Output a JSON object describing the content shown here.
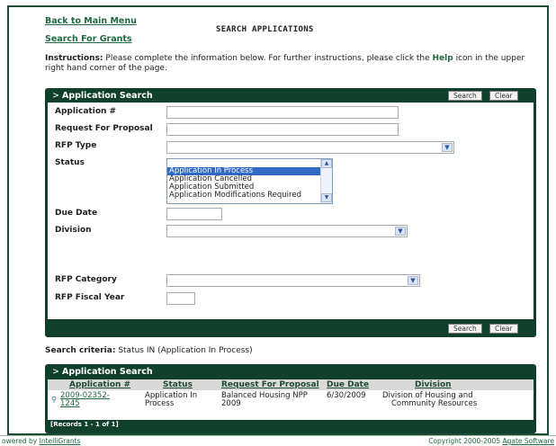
{
  "nav": {
    "back_label": "Back to Main Menu",
    "grants_label": "Search For Grants"
  },
  "page_title": "SEARCH APPLICATIONS",
  "instructions": {
    "label": "Instructions:",
    "text_before": "Please complete the information below. For further instructions, please click the",
    "help_word": "Help",
    "text_after": "icon in the upper right hand corner of the page."
  },
  "search_panel": {
    "title": "Application Search",
    "search_button": "Search",
    "clear_button": "Clear",
    "fields": {
      "application_no": {
        "label": "Application #",
        "value": ""
      },
      "rfp": {
        "label": "Request For Proposal",
        "value": ""
      },
      "rfp_type": {
        "label": "RFP Type",
        "value": ""
      },
      "status": {
        "label": "Status",
        "options": [
          "",
          "Application In Process",
          "Application Cancelled",
          "Application Submitted",
          "Application Modifications Required"
        ],
        "selected": "Application In Process"
      },
      "due_date": {
        "label": "Due Date",
        "value": ""
      },
      "division": {
        "label": "Division",
        "value": ""
      },
      "rfp_category": {
        "label": "RFP Category",
        "value": ""
      },
      "rfp_fiscal_year": {
        "label": "RFP Fiscal Year",
        "value": ""
      }
    }
  },
  "criteria": {
    "label": "Search criteria:",
    "text": "Status IN (Application In Process)"
  },
  "results_panel": {
    "title": "Application Search",
    "columns": [
      "Application #",
      "Status",
      "Request For Proposal",
      "Due Date",
      "Division"
    ],
    "rows": [
      {
        "app_line1": "2009-02352-",
        "app_line2": "1245",
        "status_line1": "Application In",
        "status_line2": "Process",
        "rfp_line1": "Balanced Housing NPP",
        "rfp_line2": "2009",
        "due_date": "6/30/2009",
        "division_line1": "Division of Housing and",
        "division_line2": "Community Resources"
      }
    ],
    "records_label": "[Records 1 - 1 of 1]"
  },
  "footer": {
    "powered_prefix": "owered by",
    "powered_link": "IntelliGrants",
    "copyright_prefix": "Copyright 2000-2005",
    "copyright_link": "Agate Software"
  },
  "colors": {
    "panel_dark_green": "#103f2c",
    "link_green": "#1f6a43",
    "selection_blue": "#316ac5"
  },
  "icons": {
    "panel_arrow": "chevron-right-icon",
    "dropdown": "chevron-down-icon",
    "row_view": "magnifier-icon"
  }
}
